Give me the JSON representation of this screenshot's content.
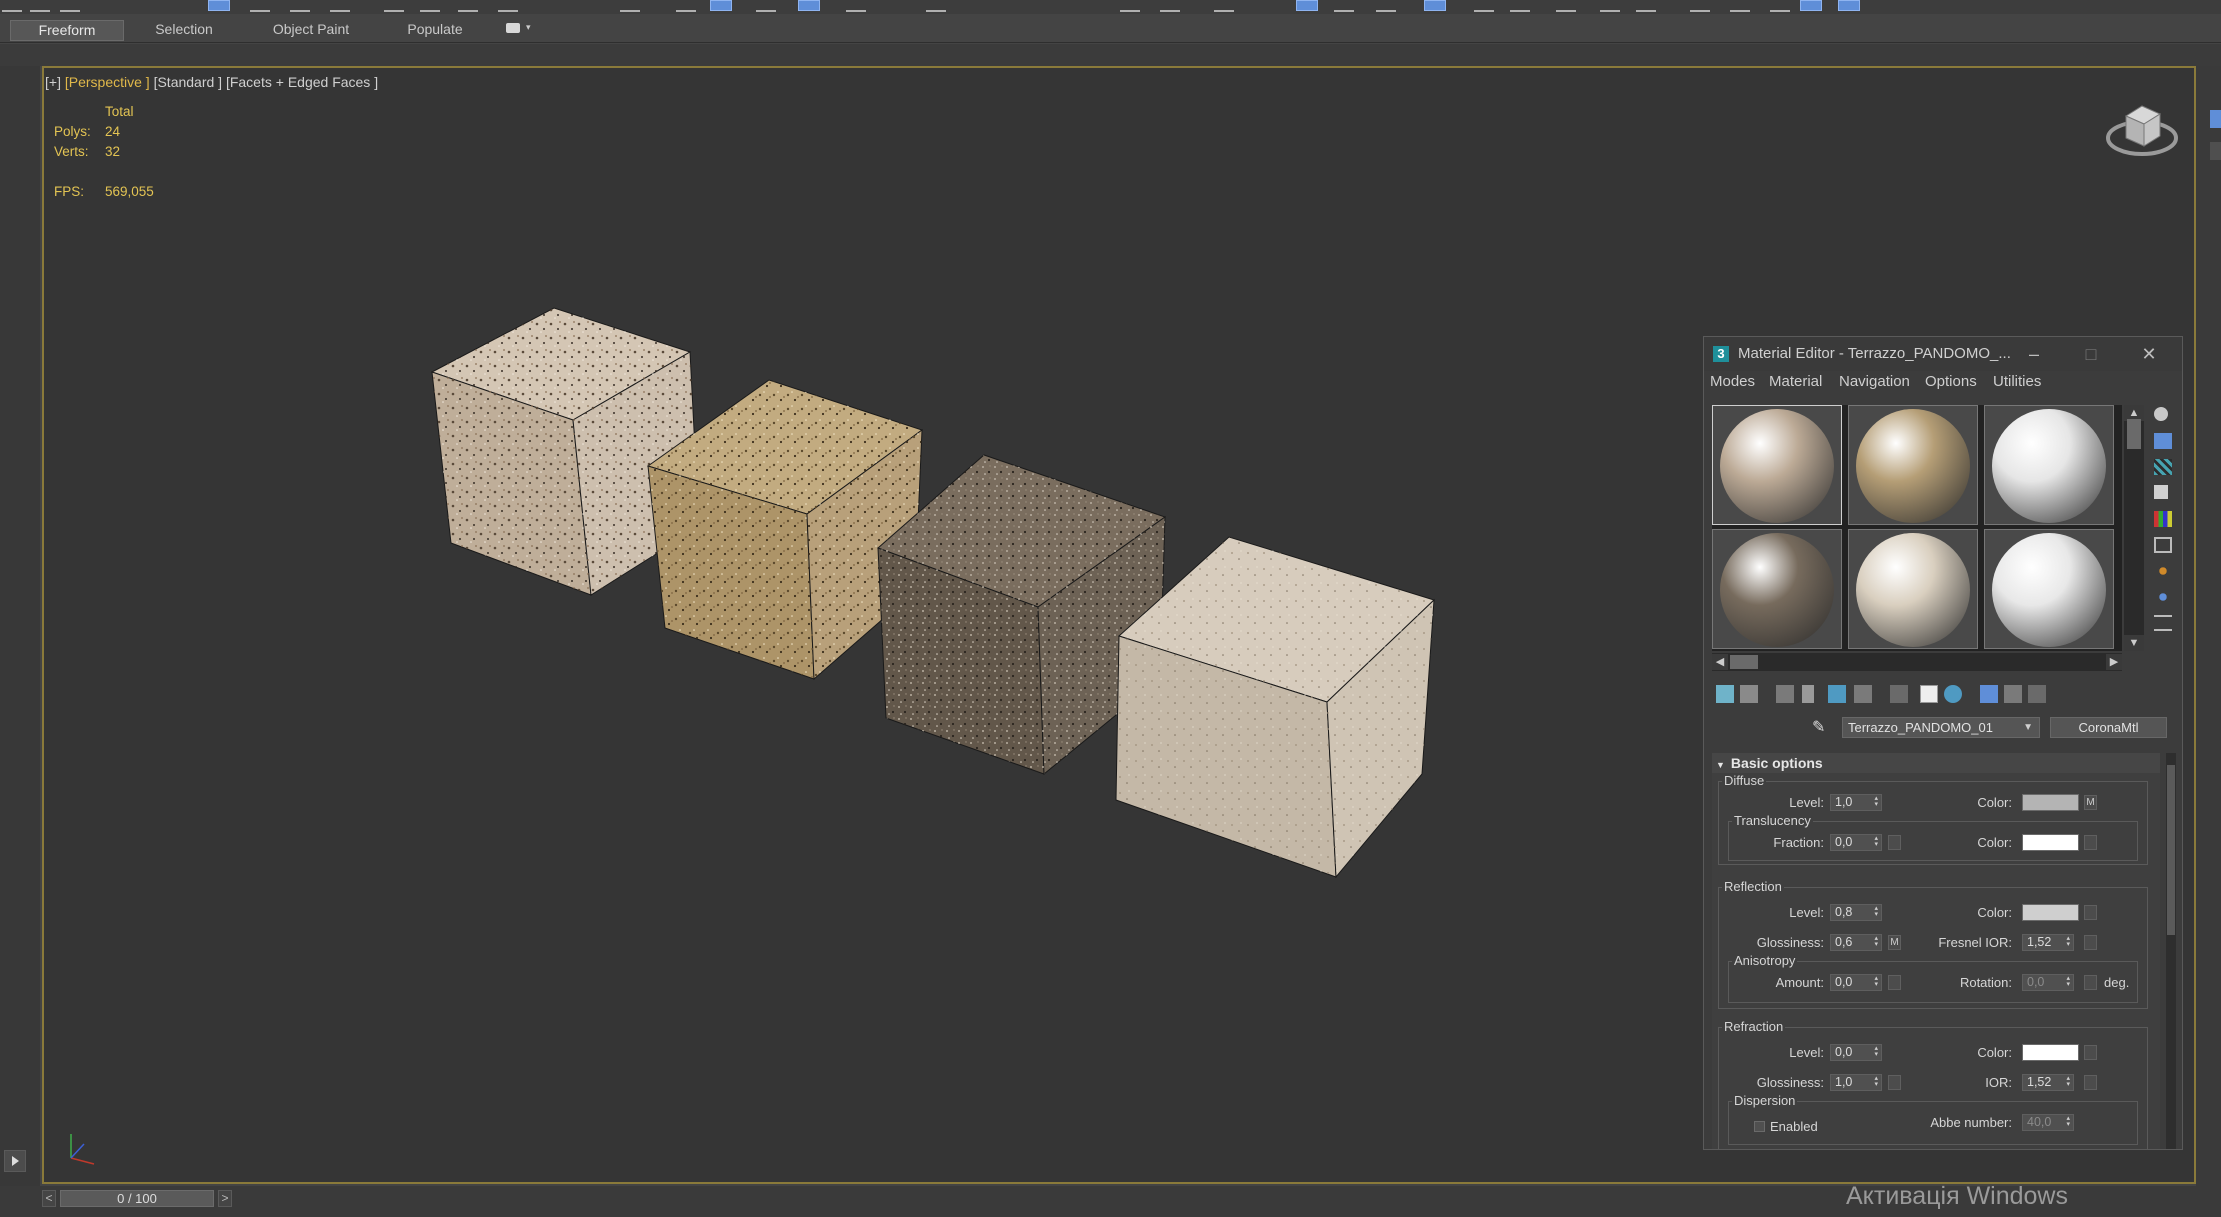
{
  "ribbon": {
    "tabs": [
      {
        "label": "Freeform",
        "active": true
      },
      {
        "label": "Selection",
        "active": false
      },
      {
        "label": "Object Paint",
        "active": false
      },
      {
        "label": "Populate",
        "active": false
      }
    ]
  },
  "viewport": {
    "label_plus": "[+]",
    "label_view": "[Perspective ]",
    "label_rest": "[Standard ] [Facets + Edged Faces ]",
    "stats": {
      "total_label": "Total",
      "polys_label": "Polys:",
      "polys_value": "24",
      "verts_label": "Verts:",
      "verts_value": "32",
      "fps_label": "FPS:",
      "fps_value": "569,055"
    },
    "objects": [
      {
        "name": "terrazzo-cube-1",
        "color": "#c4b3a0"
      },
      {
        "name": "terrazzo-cube-2",
        "color": "#b59e74"
      },
      {
        "name": "terrazzo-cube-3",
        "color": "#6a5f52"
      },
      {
        "name": "terrazzo-cube-4",
        "color": "#cfc3b2"
      }
    ],
    "accent_color": "#e3c453"
  },
  "timeline": {
    "frame": "0 / 100",
    "prev": "<",
    "next": ">"
  },
  "watermark": "Активація Windows",
  "material_editor": {
    "title": "Material Editor - Terrazzo_PANDOMO_...",
    "minimize": "–",
    "maximize": "□",
    "close": "✕",
    "menu": [
      "Modes",
      "Material",
      "Navigation",
      "Options",
      "Utilities"
    ],
    "slots": [
      {
        "color": "#bcaa96"
      },
      {
        "color": "#b59e76"
      },
      {
        "color": "#e6e6e6"
      },
      {
        "color": "#776b5d"
      },
      {
        "color": "#d9cfbf"
      },
      {
        "color": "#e8e8e8"
      }
    ],
    "material_name": "Terrazzo_PANDOMO_01",
    "material_type": "CoronaMtl",
    "rollout_title": "Basic options",
    "diffuse": {
      "title": "Diffuse",
      "level_label": "Level:",
      "level": "1,0",
      "color_label": "Color:",
      "color": "#b4b4b4",
      "map_btn": "M",
      "translucency_title": "Translucency",
      "fraction_label": "Fraction:",
      "fraction": "0,0",
      "t_color_label": "Color:",
      "t_color": "#ffffff"
    },
    "reflection": {
      "title": "Reflection",
      "level_label": "Level:",
      "level": "0,8",
      "color_label": "Color:",
      "color": "#cfcfcf",
      "gloss_label": "Glossiness:",
      "gloss": "0,6",
      "gloss_map_btn": "M",
      "fresnel_label": "Fresnel IOR:",
      "fresnel": "1,52",
      "anisotropy_title": "Anisotropy",
      "amount_label": "Amount:",
      "amount": "0,0",
      "rotation_label": "Rotation:",
      "rotation": "0,0",
      "deg_label": "deg."
    },
    "refraction": {
      "title": "Refraction",
      "level_label": "Level:",
      "level": "0,0",
      "color_label": "Color:",
      "color": "#ffffff",
      "gloss_label": "Glossiness:",
      "gloss": "1,0",
      "ior_label": "IOR:",
      "ior": "1,52",
      "dispersion_title": "Dispersion",
      "enabled_label": "Enabled",
      "abbe_label": "Abbe number:",
      "abbe": "40,0"
    }
  }
}
